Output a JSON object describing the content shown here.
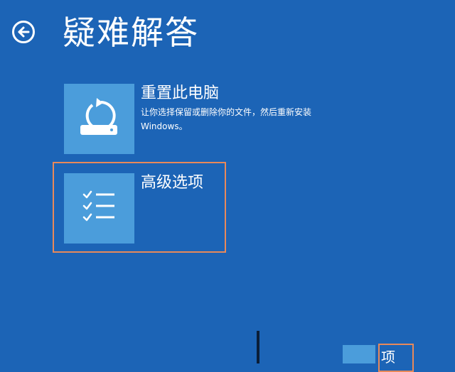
{
  "header": {
    "title": "疑难解答",
    "back_icon": "back-arrow-icon"
  },
  "options": [
    {
      "title": "重置此电脑",
      "description": "让你选择保留或删除你的文件，然后重新安装 Windows。",
      "icon": "reset-pc-icon"
    },
    {
      "title": "高级选项",
      "description": "",
      "icon": "checklist-icon"
    }
  ],
  "bottom_partial": {
    "label": "项"
  },
  "colors": {
    "background": "#1c64b6",
    "tile": "#4b9ddb",
    "highlight": "#e8895a",
    "text": "#ffffff"
  }
}
